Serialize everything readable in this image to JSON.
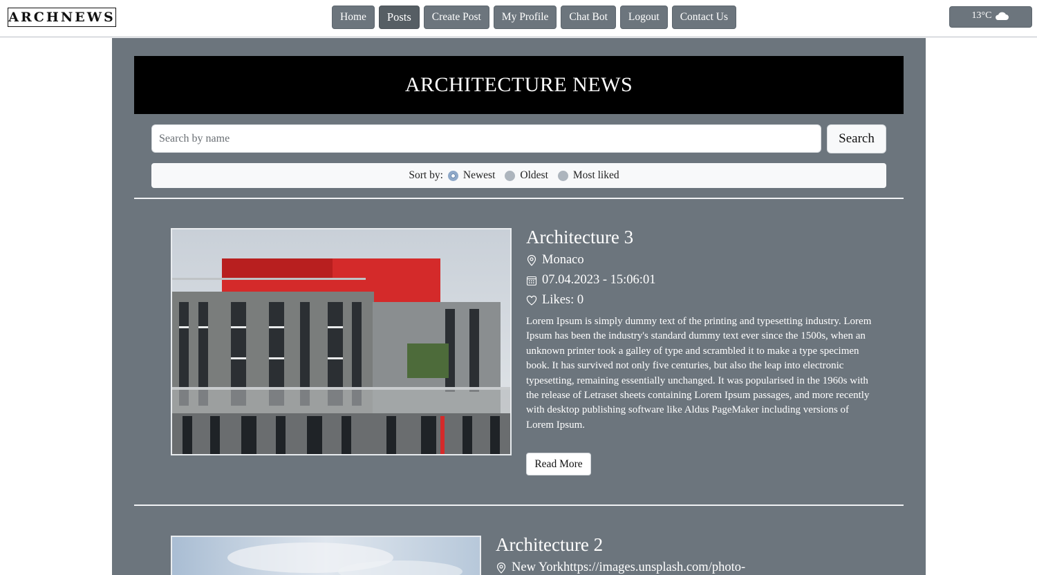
{
  "nav": {
    "logo": "ARCHNEWS",
    "links": [
      "Home",
      "Posts",
      "Create Post",
      "My Profile",
      "Chat Bot",
      "Logout",
      "Contact Us"
    ],
    "active": "Posts",
    "weather": "13°C",
    "weather_icon": "cloud-icon"
  },
  "hero": {
    "title": "ARCHITECTURE NEWS"
  },
  "search": {
    "placeholder": "Search by name",
    "value": "",
    "button_label": "Search"
  },
  "sort": {
    "label": "Sort by:",
    "options": [
      "Newest",
      "Oldest",
      "Most liked"
    ],
    "selected": "Newest"
  },
  "posts": [
    {
      "title": "Architecture 3",
      "location": "Monaco",
      "date": "07.04.2023 - 15:06:01",
      "likes": "Likes: 0",
      "body": "Lorem Ipsum is simply dummy text of the printing and typesetting industry. Lorem Ipsum has been the industry's standard dummy text ever since the 1500s, when an unknown printer took a galley of type and scrambled it to make a type specimen book. It has survived not only five centuries, but also the leap into electronic typesetting, remaining essentially unchanged. It was popularised in the 1960s with the release of Letraset sheets containing Lorem Ipsum passages, and more recently with desktop publishing software like Aldus PageMaker including versions of Lorem Ipsum.",
      "read_more": "Read More"
    },
    {
      "title": "Architecture 2",
      "location": "New Yorkhttps://images.unsplash.com/photo-"
    }
  ],
  "colors": {
    "page_bg": "#ffffff",
    "main_bg": "#6c757d",
    "nav_button": "#6c757d",
    "nav_button_active": "#565e64",
    "hero_bg": "#000000",
    "accent_red": "#d42a2a"
  },
  "icons": {
    "location": "map-pin-icon",
    "date": "calendar-icon",
    "likes": "heart-icon"
  }
}
